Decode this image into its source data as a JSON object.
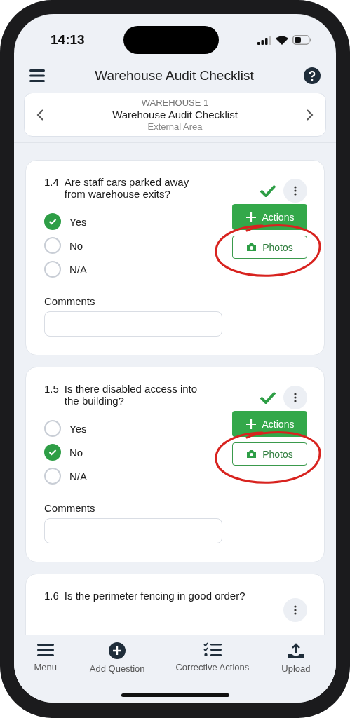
{
  "status_bar": {
    "time": "14:13"
  },
  "header": {
    "title": "Warehouse Audit Checklist"
  },
  "section_nav": {
    "overline": "WAREHOUSE 1",
    "title": "Warehouse Audit Checklist",
    "subtitle": "External Area"
  },
  "questions": [
    {
      "number": "1.4",
      "text": "Are staff cars parked away from warehouse exits?",
      "answered": true,
      "circled": true,
      "options": [
        {
          "label": "Yes",
          "selected": true
        },
        {
          "label": "No",
          "selected": false
        },
        {
          "label": "N/A",
          "selected": false
        }
      ],
      "comments_label": "Comments",
      "actions_label": "Actions",
      "photos_label": "Photos"
    },
    {
      "number": "1.5",
      "text": "Is there disabled access into the building?",
      "answered": true,
      "circled": true,
      "options": [
        {
          "label": "Yes",
          "selected": false
        },
        {
          "label": "No",
          "selected": true
        },
        {
          "label": "N/A",
          "selected": false
        }
      ],
      "comments_label": "Comments",
      "actions_label": "Actions",
      "photos_label": "Photos"
    },
    {
      "number": "1.6",
      "text": "Is the perimeter fencing in good order?"
    }
  ],
  "bottom_nav": [
    {
      "label": "Menu",
      "kind": "menu"
    },
    {
      "label": "Add Question",
      "kind": "add"
    },
    {
      "label": "Corrective Actions",
      "kind": "checklist"
    },
    {
      "label": "Upload",
      "kind": "upload"
    }
  ]
}
